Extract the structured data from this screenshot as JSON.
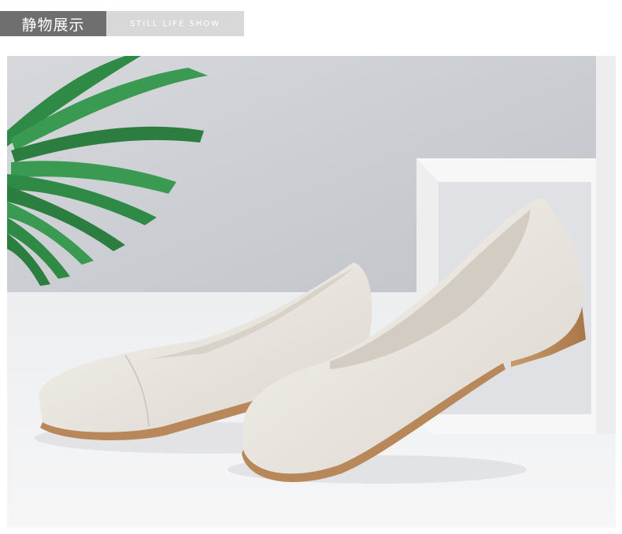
{
  "header": {
    "title_cn": "静物展示",
    "title_en": "STILL LIFE SHOW"
  },
  "photo": {
    "subject": "still-life product photo",
    "colors": {
      "wall": "#c9ccd1",
      "floor": "#e6e7ea",
      "leaf": "#2f8a46",
      "shoe": "#ece8e2",
      "heel": "#b9885a",
      "cube": "#f7f7f7"
    }
  }
}
